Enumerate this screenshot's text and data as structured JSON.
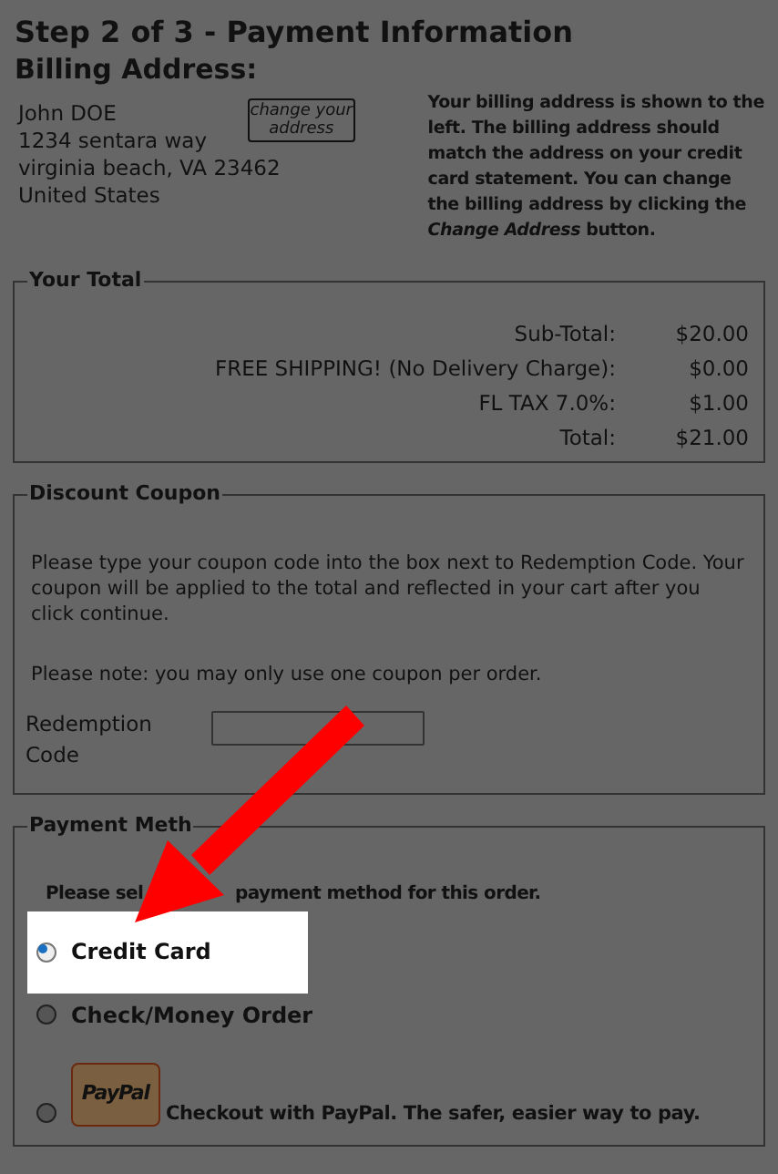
{
  "page_title": "Step 2 of 3 - Payment Information",
  "billing": {
    "heading": "Billing Address:",
    "address_lines": [
      "John DOE",
      "1234 sentara way",
      "virginia beach, VA 23462",
      "United States"
    ],
    "change_button": "change your address",
    "note": "Your billing address is shown to the left. The billing address should match the address on your credit card statement. You can change the billing address by clicking the *Change Address* button."
  },
  "total": {
    "legend": "Your Total",
    "rows": [
      {
        "label": "Sub-Total:",
        "amount": "$20.00"
      },
      {
        "label": "FREE SHIPPING! (No Delivery Charge):",
        "amount": "$0.00"
      },
      {
        "label": "FL TAX 7.0%:",
        "amount": "$1.00"
      },
      {
        "label": "Total:",
        "amount": "$21.00"
      }
    ]
  },
  "coupon": {
    "legend": "Discount Coupon",
    "paragraphs": [
      "Please type your coupon code into the box next to Redemption Code. Your coupon will be applied to the total and reflected in your cart after you click continue.",
      "Please note: you may only use one coupon per order."
    ],
    "field_label": "Redemption Code"
  },
  "payment": {
    "legend": "Payment Meth",
    "instruction_parts": [
      "Please sel",
      "payment method for this order."
    ],
    "options": [
      {
        "kind": "plain",
        "label": "Credit Card",
        "selected": true,
        "highlighted": true
      },
      {
        "kind": "plain",
        "label": "Check/Money Order",
        "selected": false,
        "highlighted": false
      },
      {
        "kind": "paypal",
        "logo": "PayPal",
        "label": "Checkout with PayPal. The safer, easier way to pay.",
        "selected": false,
        "highlighted": false
      }
    ]
  }
}
